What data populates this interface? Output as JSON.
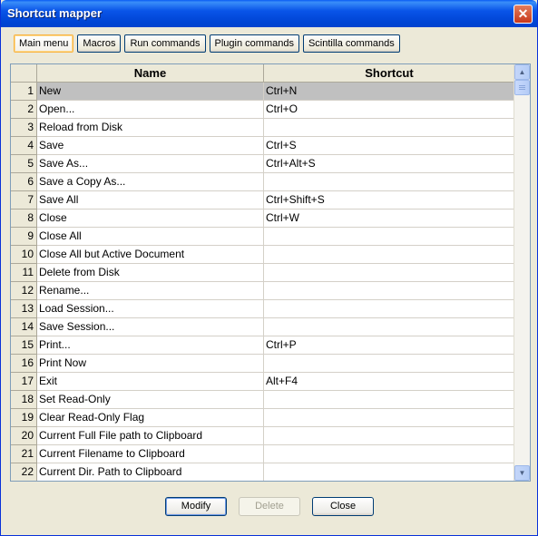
{
  "window": {
    "title": "Shortcut mapper",
    "close_glyph": "✕"
  },
  "tabs": [
    {
      "label": "Main menu",
      "active": true
    },
    {
      "label": "Macros",
      "active": false
    },
    {
      "label": "Run commands",
      "active": false
    },
    {
      "label": "Plugin commands",
      "active": false
    },
    {
      "label": "Scintilla commands",
      "active": false
    }
  ],
  "grid": {
    "columns": {
      "name": "Name",
      "shortcut": "Shortcut"
    },
    "selected_row": 1,
    "rows": [
      {
        "num": "1",
        "name": "New",
        "shortcut": "Ctrl+N"
      },
      {
        "num": "2",
        "name": "Open...",
        "shortcut": "Ctrl+O"
      },
      {
        "num": "3",
        "name": "Reload from Disk",
        "shortcut": ""
      },
      {
        "num": "4",
        "name": "Save",
        "shortcut": "Ctrl+S"
      },
      {
        "num": "5",
        "name": "Save As...",
        "shortcut": "Ctrl+Alt+S"
      },
      {
        "num": "6",
        "name": "Save a Copy As...",
        "shortcut": ""
      },
      {
        "num": "7",
        "name": "Save All",
        "shortcut": "Ctrl+Shift+S"
      },
      {
        "num": "8",
        "name": "Close",
        "shortcut": "Ctrl+W"
      },
      {
        "num": "9",
        "name": "Close All",
        "shortcut": ""
      },
      {
        "num": "10",
        "name": "Close All but Active Document",
        "shortcut": ""
      },
      {
        "num": "11",
        "name": "Delete from Disk",
        "shortcut": ""
      },
      {
        "num": "12",
        "name": "Rename...",
        "shortcut": ""
      },
      {
        "num": "13",
        "name": "Load Session...",
        "shortcut": ""
      },
      {
        "num": "14",
        "name": "Save Session...",
        "shortcut": ""
      },
      {
        "num": "15",
        "name": "Print...",
        "shortcut": "Ctrl+P"
      },
      {
        "num": "16",
        "name": "Print Now",
        "shortcut": ""
      },
      {
        "num": "17",
        "name": "Exit",
        "shortcut": "Alt+F4"
      },
      {
        "num": "18",
        "name": "Set Read-Only",
        "shortcut": ""
      },
      {
        "num": "19",
        "name": "Clear Read-Only Flag",
        "shortcut": ""
      },
      {
        "num": "20",
        "name": "Current Full File path to Clipboard",
        "shortcut": ""
      },
      {
        "num": "21",
        "name": "Current Filename to Clipboard",
        "shortcut": ""
      },
      {
        "num": "22",
        "name": "Current Dir. Path to Clipboard",
        "shortcut": ""
      }
    ]
  },
  "scrollbar": {
    "up_glyph": "▲",
    "down_glyph": "▼"
  },
  "buttons": {
    "modify": "Modify",
    "delete": "Delete",
    "close": "Close"
  }
}
